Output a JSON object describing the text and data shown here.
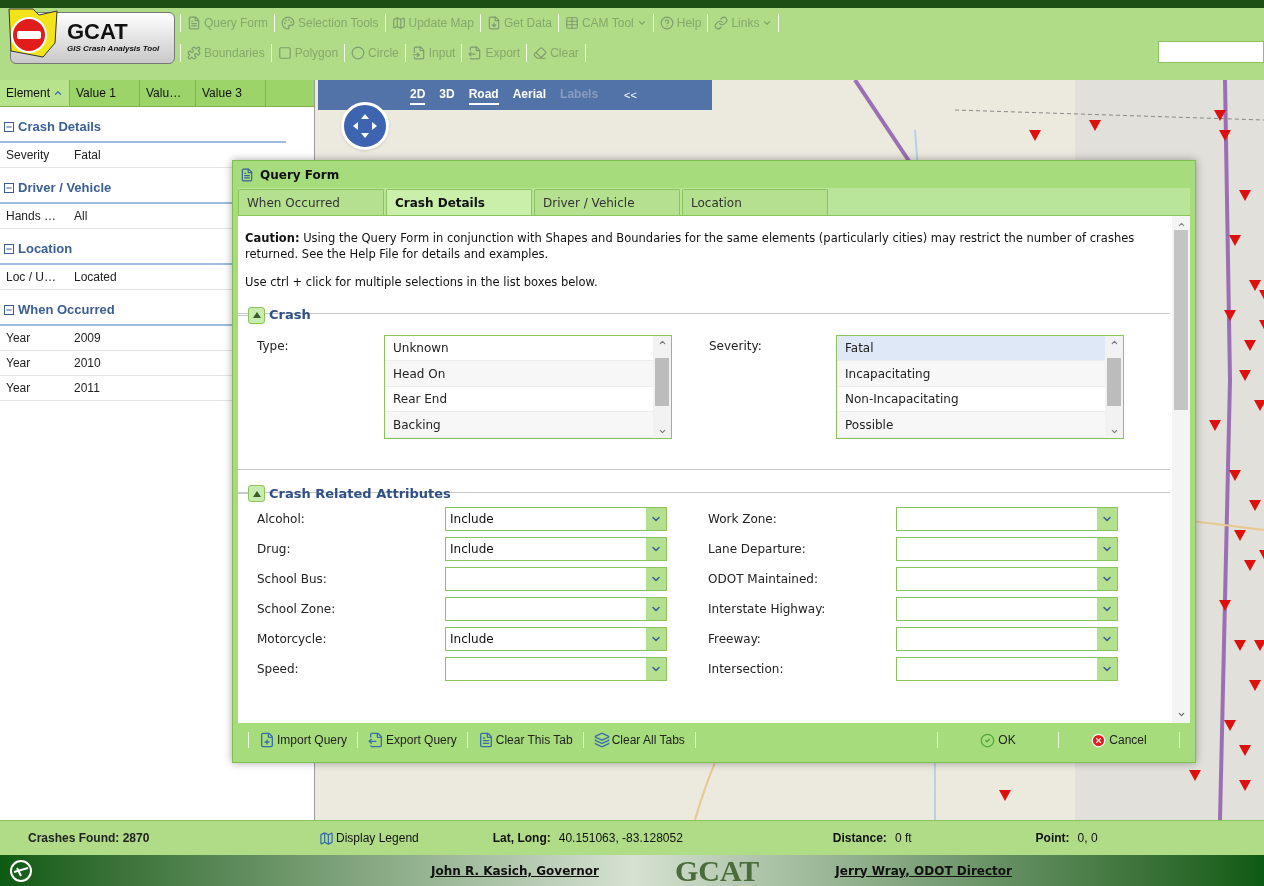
{
  "logo": {
    "title": "GCAT",
    "subtitle": "GIS Crash Analysis Tool"
  },
  "toolbar_rows": [
    [
      {
        "label": "Query Form",
        "disabled": true,
        "menu": false
      },
      {
        "label": "Selection Tools",
        "disabled": true,
        "menu": false
      },
      {
        "label": "Update Map",
        "disabled": true,
        "menu": false
      },
      {
        "label": "Get Data",
        "disabled": true,
        "menu": false
      },
      {
        "label": "CAM Tool",
        "disabled": true,
        "menu": true
      },
      {
        "label": "Help",
        "disabled": true,
        "menu": false
      },
      {
        "label": "Links",
        "disabled": true,
        "menu": true
      }
    ],
    [
      {
        "label": "Boundaries",
        "disabled": true,
        "menu": false
      },
      {
        "label": "Polygon",
        "disabled": true,
        "menu": false
      },
      {
        "label": "Circle",
        "disabled": true,
        "menu": false
      },
      {
        "label": "Input",
        "disabled": true,
        "menu": false
      },
      {
        "label": "Export",
        "disabled": true,
        "menu": false
      },
      {
        "label": "Clear",
        "disabled": true,
        "menu": false
      }
    ]
  ],
  "grid": {
    "columns": [
      {
        "label": "Element",
        "sorted": true
      },
      {
        "label": "Value 1",
        "sorted": false
      },
      {
        "label": "Valu…",
        "sorted": false
      },
      {
        "label": "Value 3",
        "sorted": false
      }
    ],
    "groups": [
      {
        "title": "Crash Details",
        "expanded": true,
        "rows": [
          [
            "Severity",
            "Fatal"
          ]
        ]
      },
      {
        "title": "Driver / Vehicle",
        "expanded": true,
        "rows": [
          [
            "Hands …",
            "All"
          ]
        ]
      },
      {
        "title": "Location",
        "expanded": true,
        "rows": [
          [
            "Loc / U…",
            "Located"
          ]
        ]
      },
      {
        "title": "When Occurred",
        "expanded": true,
        "rows": [
          [
            "Year",
            "2009"
          ],
          [
            "Year",
            "2010"
          ],
          [
            "Year",
            "2011"
          ]
        ]
      }
    ],
    "crashes_found": "Crashes Found: 2870"
  },
  "map_controls": {
    "views": [
      {
        "label": "2D",
        "selected": true,
        "disabled": false
      },
      {
        "label": "3D",
        "selected": false,
        "disabled": false
      },
      {
        "label": "Road",
        "selected": true,
        "disabled": false
      },
      {
        "label": "Aerial",
        "selected": false,
        "disabled": false
      },
      {
        "label": "Labels",
        "selected": false,
        "disabled": true
      }
    ],
    "collapse": "<<"
  },
  "dialog": {
    "title": "Query Form",
    "tabs": [
      {
        "label": "When Occurred",
        "selected": false
      },
      {
        "label": "Crash Details",
        "selected": true
      },
      {
        "label": "Driver / Vehicle",
        "selected": false
      },
      {
        "label": "Location",
        "selected": false
      }
    ],
    "caution": "**Caution:** Using the Query Form in conjunction with Shapes and Boundaries for the same elements (particularly cities) may restrict the number of crashes returned.  See the Help File for details and examples.",
    "hint": "Use ctrl + click for multiple selections in the list boxes below.",
    "crash_section": {
      "title": "Crash",
      "expanded": true,
      "lists": [
        {
          "label": "Type:",
          "items": [
            {
              "text": "Unknown",
              "selected": false
            },
            {
              "text": "Head On",
              "selected": false
            },
            {
              "text": "Rear End",
              "selected": false
            },
            {
              "text": "Backing",
              "selected": false
            }
          ]
        },
        {
          "label": "Severity:",
          "items": [
            {
              "text": "Fatal",
              "selected": true
            },
            {
              "text": "Incapacitating",
              "selected": false
            },
            {
              "text": "Non-Incapacitating",
              "selected": false
            },
            {
              "text": "Possible",
              "selected": false
            }
          ]
        }
      ]
    },
    "attributes_section": {
      "title": "Crash Related Attributes",
      "expanded": true,
      "fields": [
        {
          "label": "Alcohol:",
          "value": "Include"
        },
        {
          "label": "Work Zone:"
        },
        {
          "label": "Drug:",
          "value": "Include"
        },
        {
          "label": "Lane Departure:"
        },
        {
          "label": "School Bus:"
        },
        {
          "label": "ODOT Maintained:"
        },
        {
          "label": "School Zone:"
        },
        {
          "label": "Interstate Highway:"
        },
        {
          "label": "Motorcycle:",
          "value": "Include"
        },
        {
          "label": "Freeway:"
        },
        {
          "label": "Speed:"
        },
        {
          "label": "Intersection:"
        }
      ]
    },
    "tools": [
      "Import Query",
      "Export Query",
      "Clear This Tab",
      "Clear All Tabs"
    ],
    "ok": "OK",
    "cancel": "Cancel"
  },
  "status_bar": {
    "legend": "Display Legend",
    "lat_long_label": "Lat, Long:",
    "lat_long": "40.151063, -83.128052",
    "distance_label": "Distance:",
    "distance": "0 ft",
    "point_label": "Point:",
    "point": "0, 0"
  },
  "footer": {
    "governor": "John R. Kasich, Governor",
    "title": "GCAT",
    "director": "Jerry Wray, ODOT Director"
  }
}
